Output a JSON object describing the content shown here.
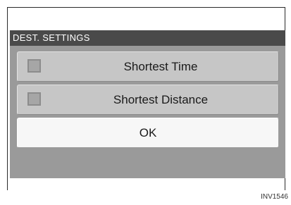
{
  "dialog": {
    "title": "DEST. SETTINGS",
    "options": [
      {
        "label": "Shortest Time",
        "checked": false
      },
      {
        "label": "Shortest Distance",
        "checked": false
      }
    ],
    "ok_label": "OK"
  },
  "figure_code": "INV1546",
  "icons": {
    "option_indicator": "checkbox-icon"
  },
  "colors": {
    "title_bar": "#4a4a4a",
    "screen_background": "#9a9a9a",
    "option_button": "#c6c6c6",
    "ok_button": "#f7f7f7"
  }
}
